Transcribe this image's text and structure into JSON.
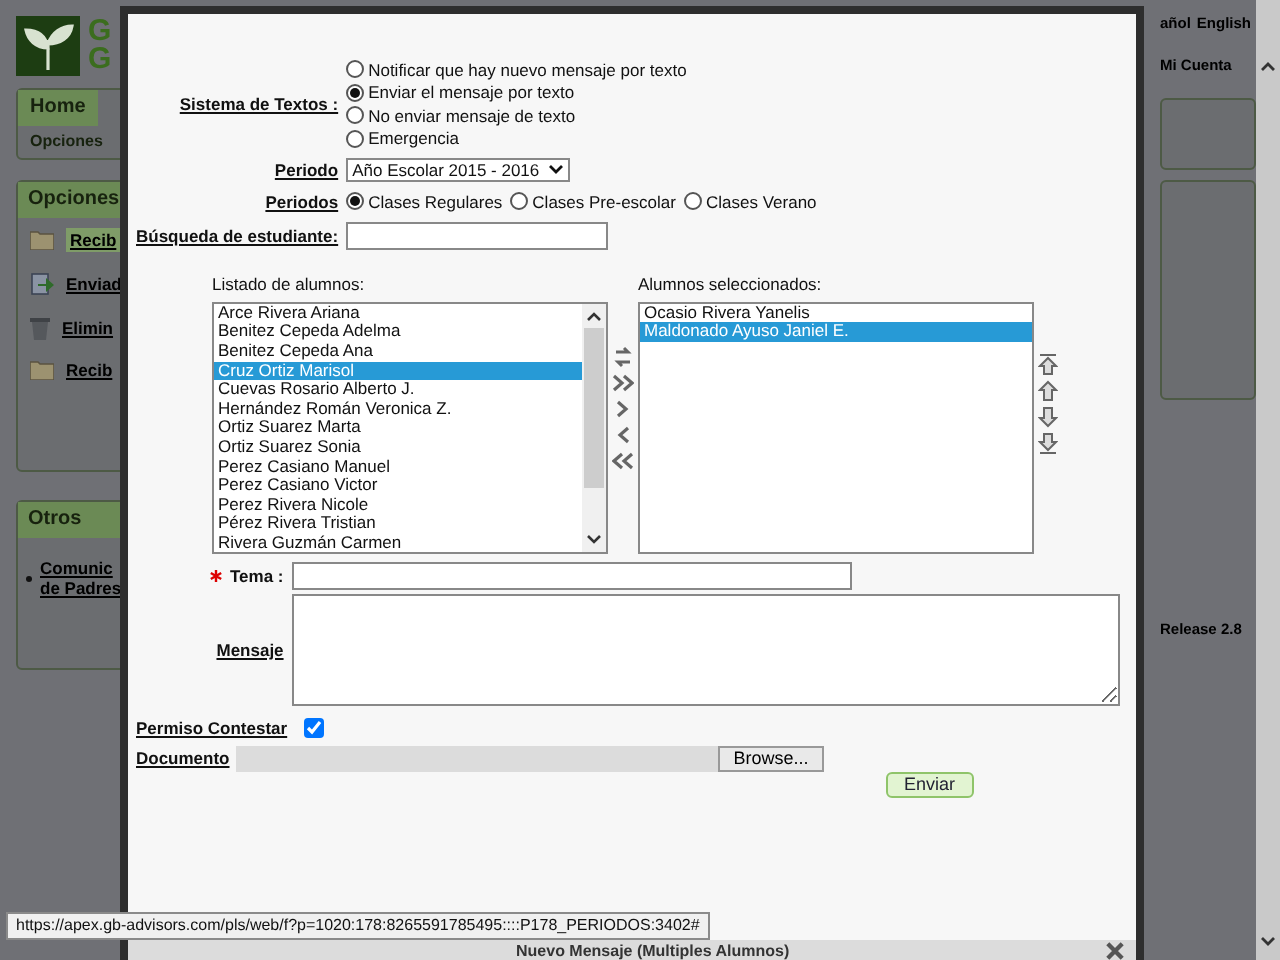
{
  "header": {
    "logo_letters": [
      "G",
      "G"
    ],
    "languages": [
      "añol",
      "English"
    ],
    "account_link": "Mi Cuenta"
  },
  "nav": {
    "tabs": [
      {
        "label": "Home",
        "selected": true
      }
    ],
    "subtabs": [
      "Opciones"
    ]
  },
  "sidebar": {
    "title": "Opciones",
    "items": [
      {
        "label": "Recib",
        "kind": "folder",
        "selected": true
      },
      {
        "label": "Enviad",
        "kind": "sent",
        "selected": false
      },
      {
        "label": "Elimin",
        "kind": "trash",
        "selected": false
      },
      {
        "label": "Recib",
        "kind": "folder",
        "selected": false
      }
    ]
  },
  "others": {
    "title": "Otros",
    "items": [
      {
        "lines": [
          "Comunic",
          "de Padres"
        ]
      }
    ]
  },
  "release": "Release 2.8",
  "modal": {
    "title": "Nuevo Mensaje (Multiples Alumnos)",
    "sms_system": {
      "label": "Sistema de Textos :",
      "options": [
        {
          "label": "Notificar que hay nuevo mensaje por texto",
          "selected": false
        },
        {
          "label": "Enviar el mensaje por texto",
          "selected": true
        },
        {
          "label": "No enviar mensaje de texto",
          "selected": false
        },
        {
          "label": "Emergencia",
          "selected": false
        }
      ]
    },
    "period": {
      "label": "Periodo",
      "value": "Año Escolar 2015 - 2016"
    },
    "periods": {
      "label": "Periodos",
      "options": [
        {
          "label": "Clases Regulares",
          "selected": true
        },
        {
          "label": "Clases Pre-escolar",
          "selected": false
        },
        {
          "label": "Clases Verano",
          "selected": false
        }
      ]
    },
    "search": {
      "label": "Búsqueda de estudiante:"
    },
    "available": {
      "label": "Listado de alumnos:",
      "items": [
        {
          "name": "Arce Rivera Ariana",
          "selected": false
        },
        {
          "name": "Benitez Cepeda Adelma",
          "selected": false
        },
        {
          "name": "Benitez Cepeda Ana",
          "selected": false
        },
        {
          "name": "Cruz Ortiz Marisol",
          "selected": true
        },
        {
          "name": "Cuevas Rosario Alberto J.",
          "selected": false
        },
        {
          "name": "Hernández Román Veronica Z.",
          "selected": false
        },
        {
          "name": "Ortiz Suarez Marta",
          "selected": false
        },
        {
          "name": "Ortiz Suarez Sonia",
          "selected": false
        },
        {
          "name": "Perez Casiano Manuel",
          "selected": false
        },
        {
          "name": "Perez Casiano Victor",
          "selected": false
        },
        {
          "name": "Perez Rivera Nicole",
          "selected": false
        },
        {
          "name": "Pérez Rivera Tristian",
          "selected": false
        },
        {
          "name": "Rivera Guzmán Carmen",
          "selected": false
        }
      ]
    },
    "chosen": {
      "label": "Alumnos seleccionados:",
      "items": [
        {
          "name": "Ocasio Rivera Yanelis",
          "selected": false
        },
        {
          "name": "Maldonado Ayuso Janiel E.",
          "selected": true
        }
      ]
    },
    "subject": {
      "label": "Tema :",
      "required": true
    },
    "message": {
      "label": "Mensaje"
    },
    "allow_reply": {
      "label": "Permiso Contestar",
      "checked": true
    },
    "document": {
      "label": "Documento",
      "button": "Browse..."
    },
    "submit": "Enviar"
  },
  "status_url": "https://apex.gb-advisors.com/pls/web/f?p=1020:178:8265591785495::::P178_PERIODOS:3402#"
}
